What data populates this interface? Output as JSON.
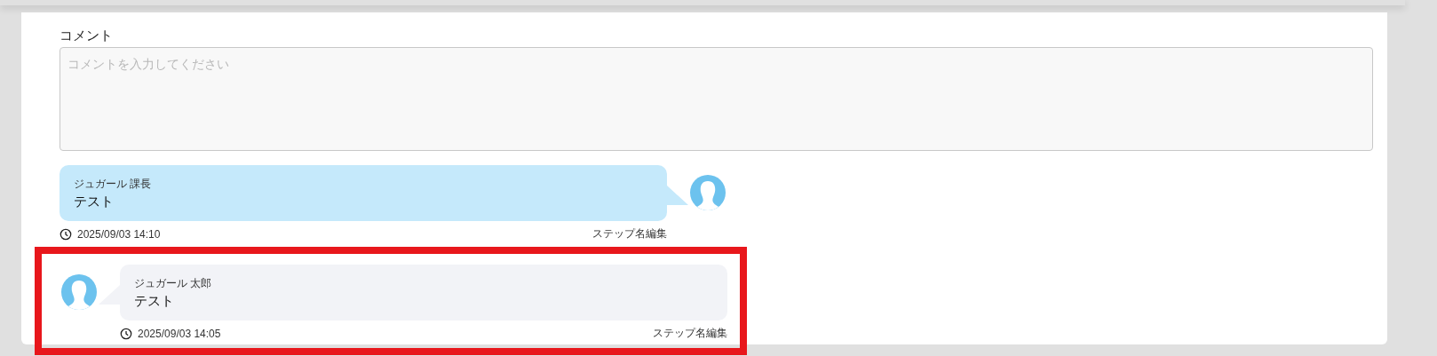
{
  "comment_field": {
    "label": "コメント",
    "placeholder": "コメントを入力してください"
  },
  "comments": [
    {
      "kind": "own",
      "author": "ジュガール 課長",
      "text": "テスト",
      "time": "2025/09/03 14:10",
      "step": "ステップ名編集",
      "highlighted": false
    },
    {
      "kind": "other",
      "author": "ジュガール 太郎",
      "text": "テスト",
      "time": "2025/09/03 14:05",
      "step": "ステップ名編集",
      "highlighted": true
    }
  ]
}
